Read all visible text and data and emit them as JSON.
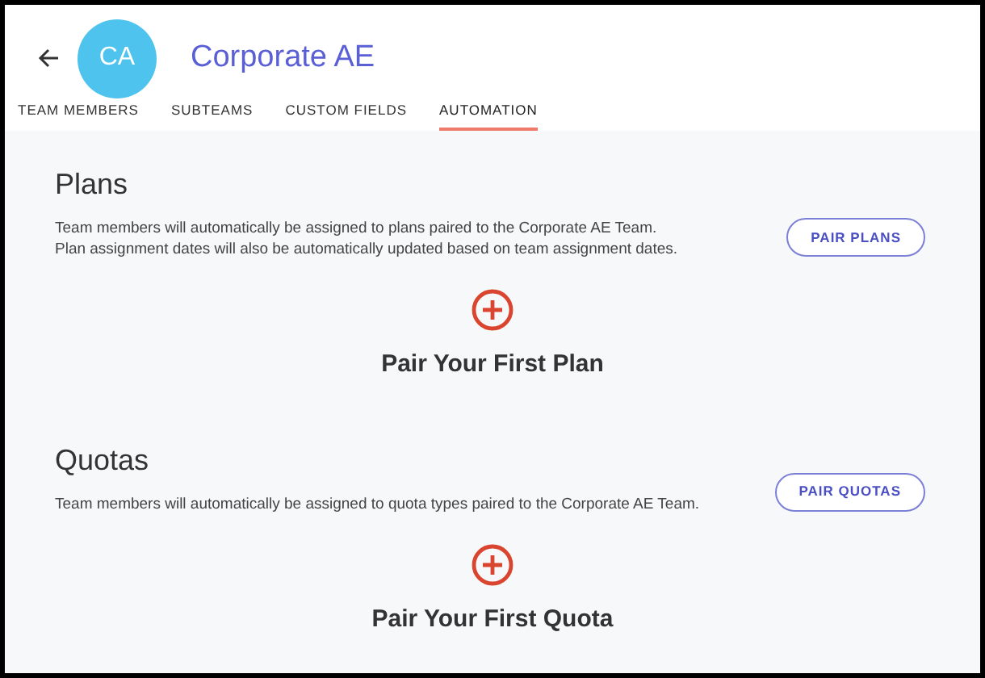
{
  "header": {
    "avatar": "CA",
    "title": "Corporate AE"
  },
  "tabs": [
    {
      "label": "TEAM MEMBERS",
      "selected": false
    },
    {
      "label": "SUBTEAMS",
      "selected": false
    },
    {
      "label": "CUSTOM FIELDS",
      "selected": false
    },
    {
      "label": "AUTOMATION",
      "selected": true
    }
  ],
  "sections": [
    {
      "title": "Plans",
      "description": [
        "Team members will automatically be assigned to plans paired to the Corporate AE Team.",
        "Plan assignment dates will also be automatically updated based on team assignment dates."
      ],
      "button": "PAIR PLANS",
      "empty_title": "Pair Your First Plan"
    },
    {
      "title": "Quotas",
      "description": [
        "Team members will automatically be assigned to quota types paired to the Corporate AE Team."
      ],
      "button": "PAIR QUOTAS",
      "empty_title": "Pair Your First Quota"
    }
  ]
}
